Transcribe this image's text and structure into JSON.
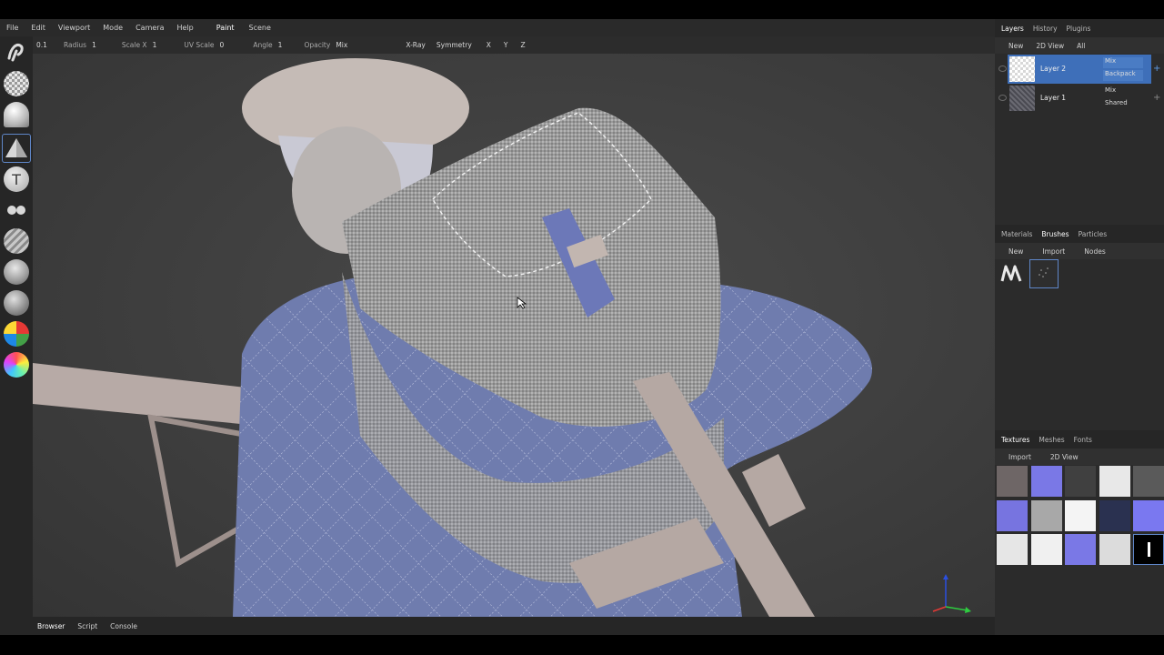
{
  "menu": {
    "items": [
      "File",
      "Edit",
      "Viewport",
      "Mode",
      "Camera",
      "Help"
    ],
    "tabs": [
      "Paint",
      "Scene"
    ]
  },
  "options": {
    "first_value": "0.1",
    "radius_label": "Radius",
    "radius_value": "1",
    "scalex_label": "Scale X",
    "scalex_value": "1",
    "uvscale_label": "UV Scale",
    "uvscale_value": "0",
    "angle_label": "Angle",
    "angle_value": "1",
    "opacity_label": "Opacity",
    "opacity_value": "Mix",
    "xray_label": "X-Ray",
    "symmetry_label": "Symmetry",
    "x_label": "X",
    "y_label": "Y",
    "z_label": "Z"
  },
  "tools": [
    "smudge-brush",
    "checker-sphere",
    "matte-sphere",
    "triangle",
    "text",
    "dots",
    "striped-sphere",
    "fur-sphere",
    "pattern-sphere",
    "color-wheel",
    "gradient-sphere"
  ],
  "layers_panel": {
    "tabs": [
      "Layers",
      "History",
      "Plugins"
    ],
    "buttons": [
      "New",
      "2D View",
      "All"
    ],
    "layers": [
      {
        "name": "Layer 2",
        "blend": "Mix",
        "group": "Backpack",
        "selected": true
      },
      {
        "name": "Layer 1",
        "blend": "Mix",
        "group": "Shared",
        "selected": false
      }
    ]
  },
  "brushes_panel": {
    "tabs": [
      "Materials",
      "Brushes",
      "Particles"
    ],
    "buttons": [
      "New",
      "Import",
      "Nodes"
    ]
  },
  "textures_panel": {
    "tabs": [
      "Textures",
      "Meshes",
      "Fonts"
    ],
    "buttons": [
      "Import",
      "2D View"
    ],
    "swatch_colors": [
      "#6e6666",
      "#7a78e6",
      "#404040",
      "#e8e8e8",
      "#5a5a5a",
      "#7774e0",
      "#a8a8a8",
      "#f4f4f4",
      "#2a3150",
      "#7a78f0",
      "#e6e6e6",
      "#f0f0f0",
      "#7a78e6",
      "#dcdcdc",
      "#000000"
    ]
  },
  "bottom_tabs": [
    "Browser",
    "Script",
    "Console"
  ],
  "colors": {
    "accent": "#3e6fb9",
    "panel": "#2b2b2b",
    "viewport_bg": "#404040"
  }
}
